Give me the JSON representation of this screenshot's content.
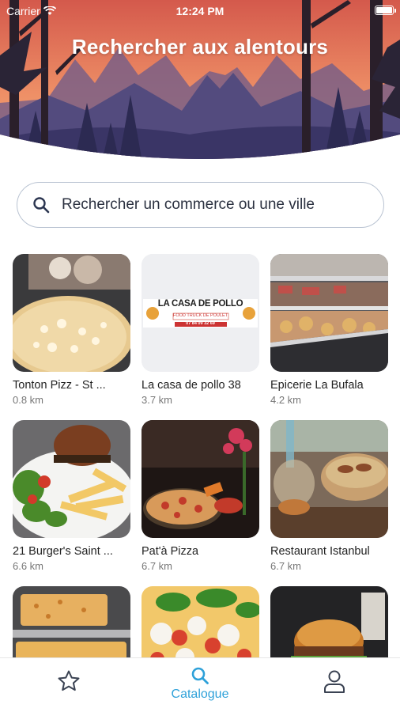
{
  "status_bar": {
    "carrier": "Carrier",
    "time": "12:24 PM"
  },
  "header": {
    "title": "Rechercher aux alentours"
  },
  "search": {
    "placeholder": "Rechercher un commerce ou une ville"
  },
  "businesses": [
    {
      "name": "Tonton Pizz - St ...",
      "distance": "0.8 km",
      "image": "pizza-photo"
    },
    {
      "name": "La casa de pollo 38",
      "distance": "3.7 km",
      "image": "logo-image",
      "logo_text": "LA CASA DE POLLO",
      "logo_subtitle": "FOOD TRUCK DE POULET",
      "logo_phone": "07 84 09 32 69"
    },
    {
      "name": "Epicerie La Bufala",
      "distance": "4.2 km",
      "image": "deli-counter-photo"
    },
    {
      "name": "21 Burger's Saint ...",
      "distance": "6.6 km",
      "image": "burger-fries-photo"
    },
    {
      "name": "Pat'à Pizza",
      "distance": "6.7 km",
      "image": "pizza-flowers-photo"
    },
    {
      "name": "Restaurant Istanbul",
      "distance": "6.7 km",
      "image": "kebab-photo"
    },
    {
      "name": "",
      "distance": "",
      "image": "cheese-bread-photo"
    },
    {
      "name": "",
      "distance": "",
      "image": "caprese-pizza-photo"
    },
    {
      "name": "",
      "distance": "",
      "image": "burger-photo"
    }
  ],
  "tabbar": {
    "favorites_icon": "star-icon",
    "catalogue_label": "Catalogue",
    "catalogue_icon": "search-icon",
    "profile_icon": "user-icon"
  },
  "colors": {
    "accent": "#2ea1d9",
    "sky_top": "#d8574a",
    "sky_bottom": "#f2b07a",
    "mountains": "#4e4a78"
  }
}
